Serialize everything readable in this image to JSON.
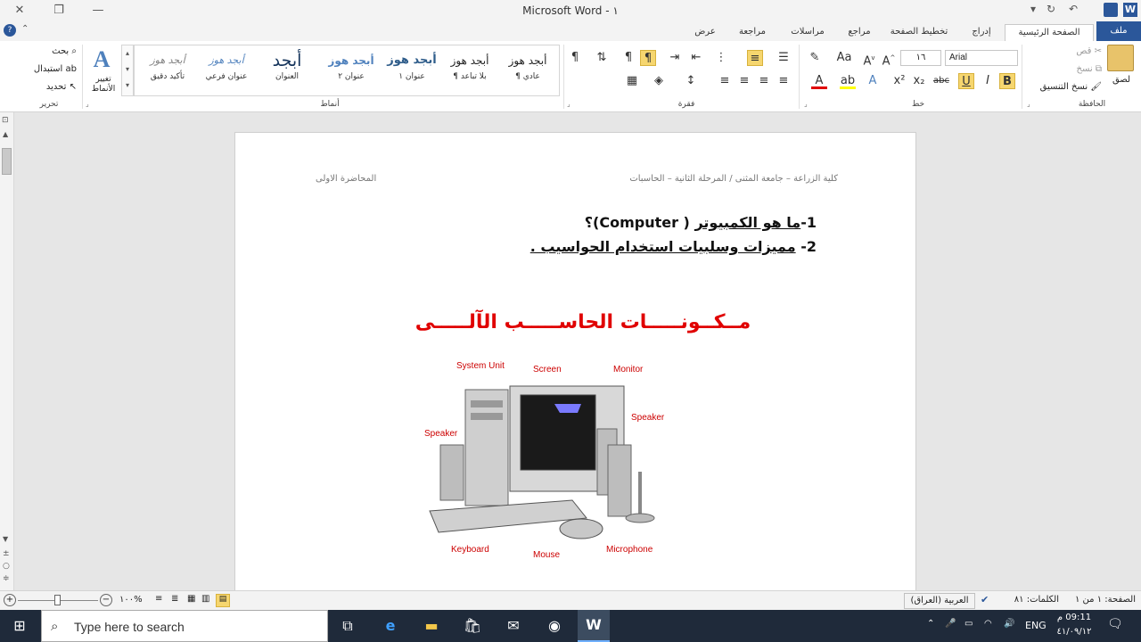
{
  "title": "Microsoft Word - ١",
  "tabs": [
    "ملف",
    "الصفحة الرئيسية",
    "إدراج",
    "تخطيط الصفحة",
    "مراجع",
    "مراسلات",
    "مراجعة",
    "عرض"
  ],
  "clipboard": {
    "paste": "لصق",
    "cut": "قص",
    "copy": "نسخ",
    "format_painter": "نسخ التنسيق",
    "label": "الحافظة"
  },
  "font": {
    "name": "Arial",
    "size": "١٦",
    "label": "خط"
  },
  "paragraph": {
    "label": "فقرة"
  },
  "styles": {
    "label": "أنماط",
    "items": [
      {
        "sample": "أبجد هوز",
        "name": "¶ عادي",
        "color": "#222",
        "size": 12,
        "weight": "normal"
      },
      {
        "sample": "أبجد هوز",
        "name": "¶ بلا تباعد",
        "color": "#222",
        "size": 12,
        "weight": "normal"
      },
      {
        "sample": "أبجد هوز",
        "name": "عنوان ١",
        "color": "#2e5c8a",
        "size": 13,
        "weight": "bold"
      },
      {
        "sample": "أبجد هوز",
        "name": "عنوان ٢",
        "color": "#4f81bd",
        "size": 12,
        "weight": "bold"
      },
      {
        "sample": "أبجد",
        "name": "العنوان",
        "color": "#17365d",
        "size": 20,
        "weight": "normal"
      },
      {
        "sample": "أبجد هوز",
        "name": "عنوان فرعي",
        "color": "#4f81bd",
        "size": 11,
        "weight": "normal"
      },
      {
        "sample": "أبجد هوز",
        "name": "تأكيد دقيق",
        "color": "#808080",
        "size": 11,
        "weight": "normal"
      }
    ],
    "change": "تغيير الأنماط"
  },
  "editing": {
    "find": "بحث",
    "replace": "استبدال",
    "select": "تحديد",
    "label": "تحرير"
  },
  "document": {
    "header_right": "كلية الزراعة – جامعة المثنى / المرحلة الثانية – الحاسبات",
    "header_left": "المحاضرة الاولى",
    "q1_num": "1-",
    "q1_text": "ما هو الكمبيوتر",
    "q1_tail": "( Computer)؟",
    "q2_num": "2-",
    "q2_text": "مميزات وسلبيات استخدام الحواسيب .",
    "heading": "مــكــونـــــات الحاســـــب الآلـــــى",
    "diagram_labels": {
      "system_unit": "System Unit",
      "screen": "Screen",
      "monitor": "Monitor",
      "speaker_left": "Speaker",
      "speaker_right": "Speaker",
      "keyboard": "Keyboard",
      "mouse": "Mouse",
      "microphone": "Microphone"
    }
  },
  "status": {
    "page": "الصفحة: ١ من ١",
    "words": "الكلمات: ٨١",
    "language": "العربية (العراق)",
    "zoom": "١٠٠%"
  },
  "taskbar": {
    "search_placeholder": "Type here to search",
    "lang": "ENG",
    "time": "09:11 م",
    "date": "٤١/٠٩/١٢"
  },
  "colors": {
    "accent": "#2b579a",
    "heading": "#e00000",
    "taskbar": "#1f2a3a"
  }
}
